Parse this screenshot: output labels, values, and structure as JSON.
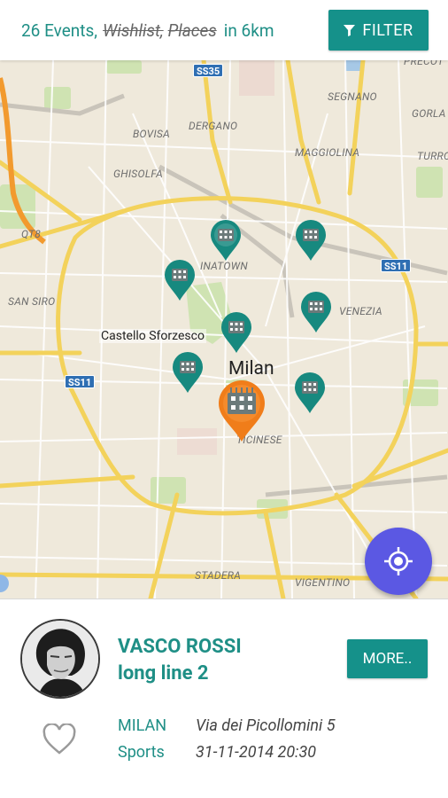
{
  "topbar": {
    "events_count": "26 Events,",
    "wishlist": "Wishlist,",
    "places": "Places",
    "range": "in 6km",
    "filter_label": "FILTER"
  },
  "map": {
    "labels": {
      "precot": "PRECOT",
      "segnano": "SEGNANO",
      "gorla": "GORLA",
      "dergano": "DERGANO",
      "bovisa": "BOVISA",
      "maggiolina": "MAGGIOLINA",
      "turro": "TURRO",
      "ghisolfa": "GHISOLFA",
      "qt8": "QT8",
      "chinatown": "INATOWN",
      "san_siro": "SAN SIRO",
      "venezia": "VENEZIA",
      "castello": "Castello Sforzesco",
      "milan": "Milan",
      "ticinese": "TICINESE",
      "stadera": "STADERA",
      "vigentino": "VIGENTINO"
    },
    "shields": {
      "ss35": "SS35",
      "ss11_east": "SS11",
      "ss11_west": "SS11"
    }
  },
  "event": {
    "title": "VASCO ROSSI",
    "subtitle": "long line 2",
    "more_label": "MORE..",
    "city": "MILAN",
    "address": "Via dei Picollomini 5",
    "category": "Sports",
    "datetime": "31-11-2014 20:30"
  },
  "colors": {
    "accent": "#15918a",
    "pin_default": "#17897f",
    "pin_selected": "#f07d1a",
    "locate_fab": "#5b58e3",
    "refresh_fab": "#6bb02c"
  },
  "icons": {
    "filter": "filter-icon",
    "locate": "my-location-icon",
    "refresh": "refresh-icon",
    "favorite": "heart-outline-icon",
    "pin": "venue-pin-icon"
  }
}
